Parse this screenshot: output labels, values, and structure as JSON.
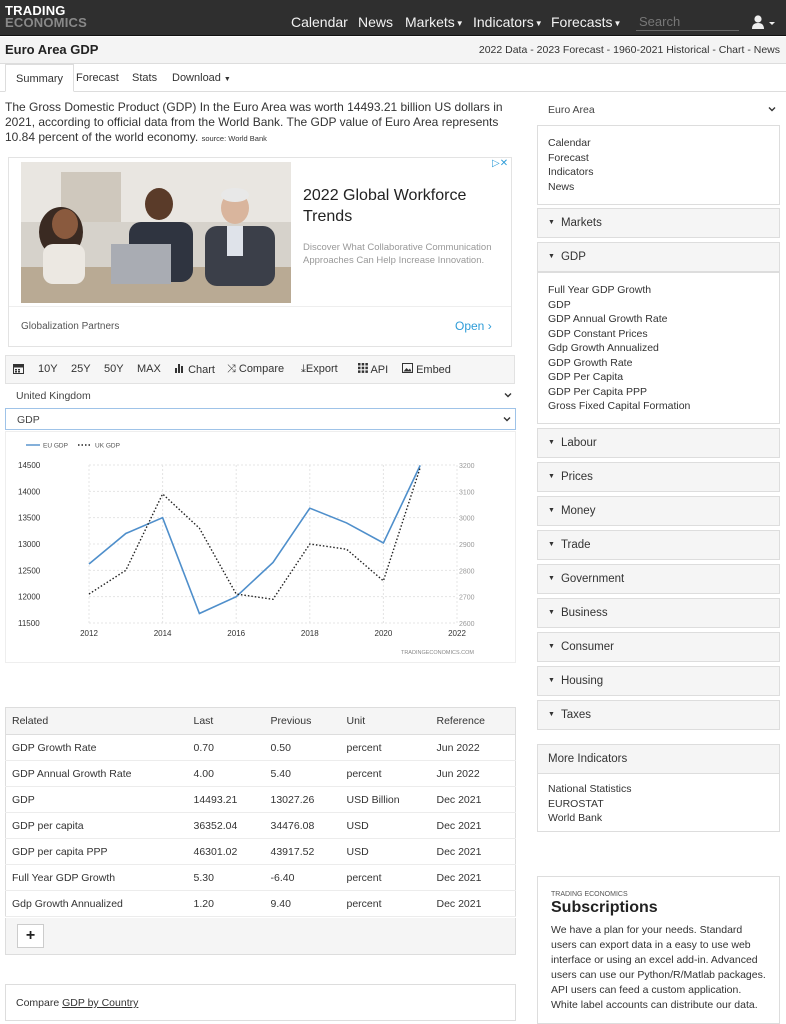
{
  "nav": {
    "logo_line1": "TRADING",
    "logo_line2": "ECONOMICS",
    "calendar": "Calendar",
    "news": "News",
    "markets": "Markets",
    "indicators": "Indicators",
    "forecasts": "Forecasts",
    "search_placeholder": "Search"
  },
  "header": {
    "title": "Euro Area GDP",
    "subtitle": "2022 Data - 2023 Forecast - 1960-2021 Historical - Chart - News"
  },
  "tabs": [
    "Summary",
    "Forecast",
    "Stats",
    "Download"
  ],
  "intro": {
    "text": "The Gross Domestic Product (GDP) In the Euro Area was worth 14493.21 billion US dollars in 2021, according to official data from the World Bank. The GDP value of Euro Area represents 10.84 percent of the world economy.",
    "source": "source: World Bank"
  },
  "ad": {
    "headline": "2022 Global Workforce Trends",
    "body": "Discover What Collaborative Communication Approaches Can Help Increase Innovation.",
    "advertiser": "Globalization Partners",
    "cta": "Open"
  },
  "toolbar": {
    "r10y": "10Y",
    "r25y": "25Y",
    "r50y": "50Y",
    "max": "MAX",
    "chart": "Chart",
    "compare": "Compare",
    "export": "Export",
    "api": "API",
    "embed": "Embed",
    "country_select": "United Kingdom",
    "indicator_select": "GDP"
  },
  "chart_data": {
    "type": "line",
    "x": [
      2012,
      2013,
      2014,
      2015,
      2016,
      2017,
      2018,
      2019,
      2020,
      2021
    ],
    "series": [
      {
        "name": "EU GDP",
        "axis": "left",
        "color": "#4f8fcb",
        "style": "solid",
        "values": [
          12620,
          13200,
          13500,
          11680,
          12000,
          12650,
          13680,
          13400,
          13020,
          14493
        ]
      },
      {
        "name": "UK GDP",
        "axis": "right",
        "color": "#222222",
        "style": "dotted",
        "values": [
          2710,
          2800,
          3090,
          2960,
          2710,
          2690,
          2900,
          2880,
          2760,
          3190
        ]
      }
    ],
    "xticks": [
      "2012",
      "2014",
      "2016",
      "2018",
      "2020",
      "2022"
    ],
    "yticks_left": [
      "14500",
      "14000",
      "13500",
      "13000",
      "12500",
      "12000",
      "11500"
    ],
    "yticks_right": [
      "3200",
      "3100",
      "3000",
      "2900",
      "2800",
      "2700",
      "2600"
    ],
    "xlim": [
      2012,
      2022
    ],
    "ylim_left": [
      11500,
      14500
    ],
    "ylim_right": [
      2600,
      3200
    ],
    "grid": true,
    "legend_position": "top-left",
    "watermark": "TRADINGECONOMICS.COM"
  },
  "related": {
    "headers": [
      "Related",
      "Last",
      "Previous",
      "Unit",
      "Reference"
    ],
    "rows": [
      [
        "GDP Growth Rate",
        "0.70",
        "0.50",
        "percent",
        "Jun 2022"
      ],
      [
        "GDP Annual Growth Rate",
        "4.00",
        "5.40",
        "percent",
        "Jun 2022"
      ],
      [
        "GDP",
        "14493.21",
        "13027.26",
        "USD Billion",
        "Dec 2021"
      ],
      [
        "GDP per capita",
        "36352.04",
        "34476.08",
        "USD",
        "Dec 2021"
      ],
      [
        "GDP per capita PPP",
        "46301.02",
        "43917.52",
        "USD",
        "Dec 2021"
      ],
      [
        "Full Year GDP Growth",
        "5.30",
        "-6.40",
        "percent",
        "Dec 2021"
      ],
      [
        "Gdp Growth Annualized",
        "1.20",
        "9.40",
        "percent",
        "Dec 2021"
      ]
    ],
    "plus": "+"
  },
  "compare": {
    "prefix": "Compare ",
    "link": "GDP by Country"
  },
  "sidebar": {
    "region": "Euro Area",
    "top_links": [
      "Calendar",
      "Forecast",
      "Indicators",
      "News"
    ],
    "markets": "Markets",
    "gdp": "GDP",
    "gdp_links": [
      "Full Year GDP Growth",
      "GDP",
      "GDP Annual Growth Rate",
      "GDP Constant Prices",
      "Gdp Growth Annualized",
      "GDP Growth Rate",
      "GDP Per Capita",
      "GDP Per Capita PPP",
      "Gross Fixed Capital Formation"
    ],
    "sections": [
      "Labour",
      "Prices",
      "Money",
      "Trade",
      "Government",
      "Business",
      "Consumer",
      "Housing",
      "Taxes"
    ],
    "more_indicators": "More Indicators",
    "more_links": [
      "National Statistics",
      "EUROSTAT",
      "World Bank"
    ]
  },
  "subscriptions": {
    "kicker": "TRADING ECONOMICS",
    "title": "Subscriptions",
    "text": "We have a plan for your needs. Standard users can export data in a easy to use web interface or using an excel add-in. Advanced users can use our Python/R/Matlab packages. API users can feed a custom application. White label accounts can distribute our data."
  }
}
